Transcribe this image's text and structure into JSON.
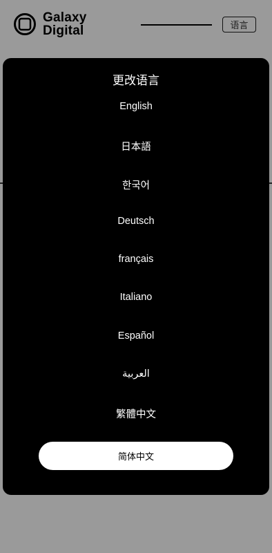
{
  "header": {
    "logo_line1": "Galaxy",
    "logo_line2": "Digital",
    "language_button": "语言"
  },
  "modal": {
    "title": "更改语言",
    "languages": [
      "English",
      "日本語",
      "한국어",
      "Deutsch",
      "français",
      "Italiano",
      "Español",
      "العربية",
      "繁體中文"
    ],
    "selected_language": "简体中文"
  }
}
